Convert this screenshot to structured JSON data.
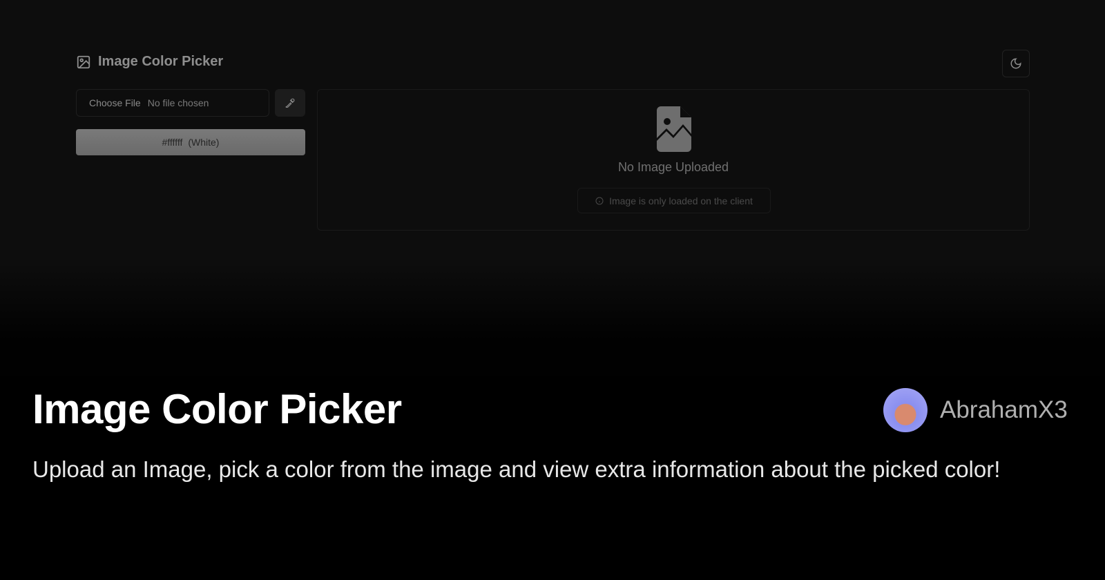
{
  "app": {
    "title": "Image Color Picker",
    "file_input": {
      "button": "Choose File",
      "status": "No file chosen"
    },
    "selected_color": {
      "hex": "#ffffff",
      "name": "(White)"
    },
    "preview": {
      "empty_title": "No Image Uploaded",
      "hint": "Image is only loaded on the client"
    }
  },
  "card": {
    "title": "Image Color Picker",
    "description": "Upload an Image, pick a color from the image and view extra information about the picked color!",
    "author": "AbrahamX3"
  },
  "colors": {
    "background": "#0d0d0d",
    "swatch": "#ffffff"
  }
}
